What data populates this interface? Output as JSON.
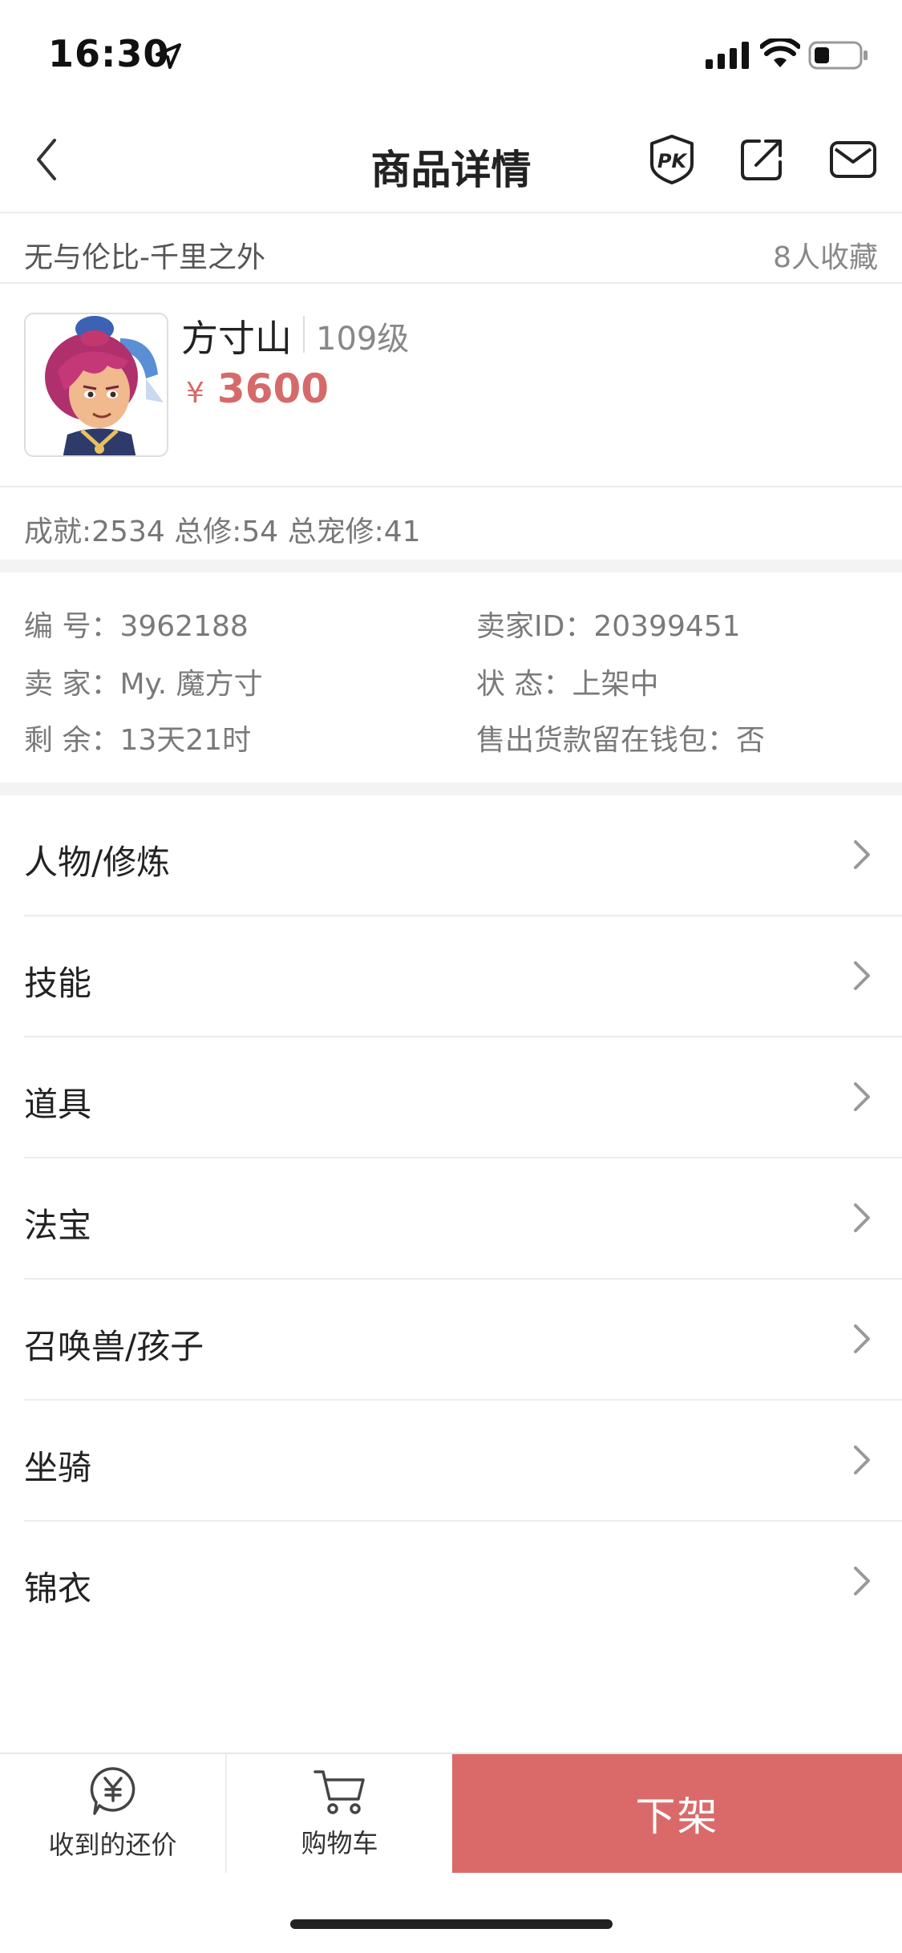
{
  "status_bar": {
    "time": "16:30"
  },
  "nav": {
    "title": "商品详情",
    "icons": [
      "back-icon",
      "pk-icon",
      "share-icon",
      "mail-icon"
    ]
  },
  "header": {
    "server": "无与伦比-千里之外",
    "favorites": "8人收藏"
  },
  "product": {
    "role": "方寸山",
    "level": "109级",
    "currency": "¥",
    "price": "3600",
    "stats": "成就:2534 总修:54 总宠修:41"
  },
  "info": {
    "id_label": "编 号：",
    "id_value": "3962188",
    "seller_id_label": "卖家ID：",
    "seller_id_value": "20399451",
    "seller_label": "卖 家：",
    "seller_value": "My. 魔方寸",
    "status_label": "状 态：",
    "status_value": "上架中",
    "remain_label": "剩 余：",
    "remain_value": "13天21时",
    "wallet_label": "售出货款留在钱包：",
    "wallet_value": "否"
  },
  "menu": [
    {
      "label": "人物/修炼"
    },
    {
      "label": "技能"
    },
    {
      "label": "道具"
    },
    {
      "label": "法宝"
    },
    {
      "label": "召唤兽/孩子"
    },
    {
      "label": "坐骑"
    },
    {
      "label": "锦衣"
    }
  ],
  "bottom_bar": {
    "offers_label": "收到的还价",
    "cart_label": "购物车",
    "delist_label": "下架"
  },
  "colors": {
    "accent": "#d96a69",
    "price": "#d66a6a"
  }
}
